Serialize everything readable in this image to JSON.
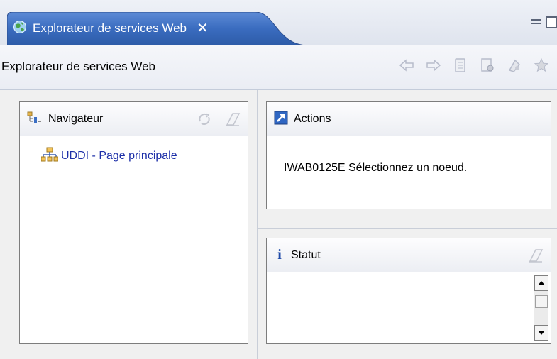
{
  "tab": {
    "title": "Explorateur de services Web",
    "close_glyph": "✕",
    "icon": "globe-icon"
  },
  "window_controls": {
    "minimize": "minimize-icon",
    "maximize": "maximize-icon"
  },
  "toolbar": {
    "title": "Explorateur de services Web",
    "icons": [
      "back-arrow-icon",
      "forward-arrow-icon",
      "history-icon",
      "wsdl-page-icon",
      "uddi-page-icon",
      "favorites-star-icon"
    ]
  },
  "navigator": {
    "title": "Navigateur",
    "icon": "navigator-tree-icon",
    "header_icons": [
      "refresh-icon",
      "clear-icon"
    ],
    "items": [
      {
        "label": "UDDI - Page principale",
        "icon": "uddi-registry-icon"
      }
    ]
  },
  "actions": {
    "title": "Actions",
    "icon": "actions-arrow-icon",
    "message": "IWAB0125E Sélectionnez un noeud."
  },
  "status": {
    "title": "Statut",
    "icon": "info-icon",
    "info_glyph": "i",
    "header_icons": [
      "clear-icon"
    ],
    "content": ""
  },
  "colors": {
    "active_tab": "#2f60b0",
    "link": "#1d2fa8",
    "panel_border": "#7d7d7d"
  }
}
